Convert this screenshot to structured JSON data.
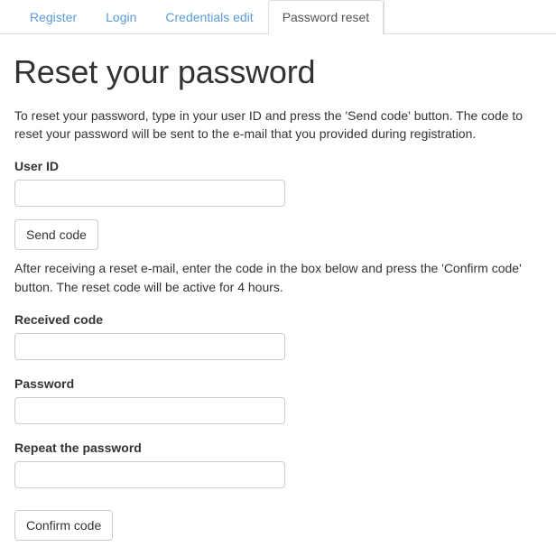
{
  "nav": {
    "tabs": [
      {
        "label": "Register",
        "active": false
      },
      {
        "label": "Login",
        "active": false
      },
      {
        "label": "Credentials edit",
        "active": false
      },
      {
        "label": "Password reset",
        "active": true
      }
    ]
  },
  "page": {
    "title": "Reset your password",
    "intro_paragraph": "To reset your password, type in your user ID and press the 'Send code' button. The code to reset your password will be sent to the e-mail that you provided during registration.",
    "code_paragraph": "After receiving a reset e-mail, enter the code in the box below and press the 'Confirm code' button. The reset code will be active for 4 hours."
  },
  "form": {
    "user_id": {
      "label": "User ID",
      "value": "",
      "placeholder": ""
    },
    "received_code": {
      "label": "Received code",
      "value": "",
      "placeholder": ""
    },
    "password": {
      "label": "Password",
      "value": "",
      "placeholder": ""
    },
    "repeat_password": {
      "label": "Repeat the password",
      "value": "",
      "placeholder": ""
    },
    "send_code_button": "Send code",
    "confirm_code_button": "Confirm code"
  },
  "colors": {
    "link": "#5b9bd5",
    "text": "#333333",
    "border": "#dddddd",
    "input_border": "#cccccc",
    "active_tab_text": "#555555"
  }
}
